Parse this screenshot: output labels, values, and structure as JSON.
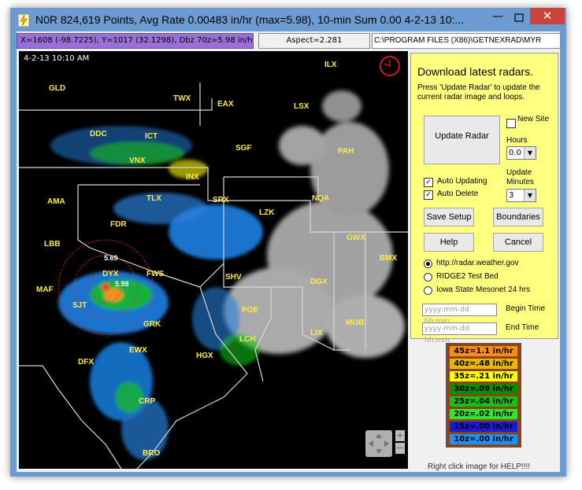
{
  "window": {
    "title": "N0R 824,619 Points, Avg Rate 0.00483 in/hr (max=5.98), 10-min Sum 0.00  4-2-13 10:...",
    "min_glyph": "—",
    "max_glyph": "☐",
    "close_glyph": "✕"
  },
  "status": {
    "coords": "X=1608 (-98.7225), Y=1017 (32.1298), Dbz 70z=5.98 in/hr",
    "aspect": "Aspect=2.281",
    "path": "C:\\PROGRAM FILES (X86)\\GETNEXRAD\\MYR"
  },
  "map": {
    "timestamp": "4-2-13 10:10 AM",
    "stations": [
      {
        "id": "LX",
        "label": "ILX"
      },
      {
        "id": "GLD",
        "label": "GLD"
      },
      {
        "id": "TWX",
        "label": "TWX"
      },
      {
        "id": "EAX",
        "label": "EAX"
      },
      {
        "id": "LSX",
        "label": "LSX"
      },
      {
        "id": "DDC",
        "label": "DDC"
      },
      {
        "id": "ICT",
        "label": "ICT"
      },
      {
        "id": "SGF",
        "label": "SGF"
      },
      {
        "id": "VNX",
        "label": "VNX"
      },
      {
        "id": "INX",
        "label": "INX"
      },
      {
        "id": "PAH",
        "label": "PAH"
      },
      {
        "id": "AMA",
        "label": "AMA"
      },
      {
        "id": "TLX",
        "label": "TLX"
      },
      {
        "id": "SRX",
        "label": "SRX"
      },
      {
        "id": "LZK",
        "label": "LZK"
      },
      {
        "id": "NQA",
        "label": "NQA"
      },
      {
        "id": "FDR",
        "label": "FDR"
      },
      {
        "id": "LBB",
        "label": "LBB"
      },
      {
        "id": "GWX",
        "label": "GWX"
      },
      {
        "id": "DYX",
        "label": "DYX"
      },
      {
        "id": "FWS",
        "label": "FWS"
      },
      {
        "id": "SHV",
        "label": "SHV"
      },
      {
        "id": "DGX",
        "label": "DGX"
      },
      {
        "id": "BMX",
        "label": "BMX"
      },
      {
        "id": "MAF",
        "label": "MAF"
      },
      {
        "id": "SJT",
        "label": "SJT"
      },
      {
        "id": "POE",
        "label": "POE"
      },
      {
        "id": "GRK",
        "label": "GRK"
      },
      {
        "id": "LCH",
        "label": "LCH"
      },
      {
        "id": "LIX",
        "label": "LIX"
      },
      {
        "id": "MOB",
        "label": "MOB"
      },
      {
        "id": "DFX",
        "label": "DFX"
      },
      {
        "id": "EWX",
        "label": "EWX"
      },
      {
        "id": "HGX",
        "label": "HGX"
      },
      {
        "id": "CRP",
        "label": "CRP"
      },
      {
        "id": "BRO",
        "label": "BRO"
      }
    ],
    "max_value_1": "5.69",
    "max_value_2": "5.98"
  },
  "panel": {
    "title": "Download latest radars.",
    "description": "Press 'Update Radar' to update the current radar image and loops.",
    "update_button": "Update Radar",
    "new_site_label": "New Site",
    "hours_label": "Hours",
    "hours_value": "0.0",
    "auto_updating_label": "Auto Updating",
    "auto_updating_checked": true,
    "update_minutes_label": "Update Minutes",
    "minutes_value": "3",
    "auto_delete_label": "Auto Delete",
    "auto_delete_checked": true,
    "save_setup": "Save Setup",
    "boundaries": "Boundaries",
    "help": "Help",
    "cancel": "Cancel",
    "sources": [
      {
        "label": "http://radar.weather.gov",
        "selected": true
      },
      {
        "label": "RIDGE2 Test Bed",
        "selected": false
      },
      {
        "label": "Iowa State Mesonet 24 hrs",
        "selected": false
      }
    ],
    "date_placeholder": "yyyy-mm-dd hh:mm",
    "begin_time_label": "Begin Time",
    "end_time_label": "End  Time"
  },
  "legend": [
    {
      "label": "45z=1.1 in/hr",
      "color": "#ff8c1a",
      "text": "#000000"
    },
    {
      "label": "40z=.48 in/hr",
      "color": "#e6b800",
      "text": "#000000"
    },
    {
      "label": "35z=.21 in/hr",
      "color": "#ffff00",
      "text": "#000000"
    },
    {
      "label": "30z=.09 in/hr",
      "color": "#0b8a0b",
      "text": "#000000"
    },
    {
      "label": "25z=.04 in/hr",
      "color": "#19c019",
      "text": "#000000"
    },
    {
      "label": "20z=.02 in/hr",
      "color": "#2ee62e",
      "text": "#000000"
    },
    {
      "label": "15z=.00 in/hr",
      "color": "#1a1ad8",
      "text": "#000000"
    },
    {
      "label": "10z=.00 in/hr",
      "color": "#1e90ff",
      "text": "#000000"
    }
  ],
  "footer_help": "Right click image for HELP!!!!"
}
